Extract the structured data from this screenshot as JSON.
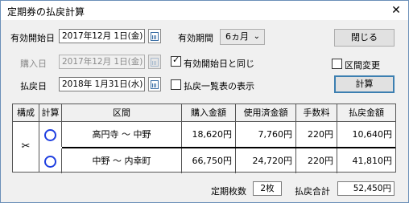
{
  "window": {
    "title": "定期券の払戻計算",
    "close_glyph": "✕"
  },
  "form": {
    "start_label": "有効開始日",
    "start_value": "2017年12月 1日(金)",
    "purchase_label": "購入日",
    "purchase_value": "2017年12月 1日(金)",
    "refund_label": "払戻日",
    "refund_value": "2018年 1月31日(水)",
    "period_label": "有効期間",
    "period_value": "6ヵ月",
    "same_as_start_label": "有効開始日と同じ",
    "same_as_start_checked": true,
    "show_list_label": "払戻一覧表の表示",
    "show_list_checked": false,
    "section_change_label": "区間変更",
    "section_change_checked": false,
    "close_button": "閉じる",
    "calc_button": "計算"
  },
  "table": {
    "headers": [
      "構成",
      "計算",
      "区間",
      "購入金額",
      "使用済金額",
      "手数料",
      "払戻金額"
    ],
    "composition_icon": "scissors-icon",
    "composition_glyph": "✂",
    "rows": [
      {
        "calc_icon": "circle-icon",
        "section": "高円寺 ～ 中野",
        "purchase": "18,620円",
        "used": "7,760円",
        "fee": "220円",
        "refund": "10,640円"
      },
      {
        "calc_icon": "circle-icon",
        "section": "中野 ～ 内幸町",
        "purchase": "66,750円",
        "used": "24,720円",
        "fee": "220円",
        "refund": "41,810円"
      }
    ]
  },
  "footer": {
    "count_label": "定期枚数",
    "count_value": "2枚",
    "total_label": "払戻合計",
    "total_value": "52,450円"
  }
}
